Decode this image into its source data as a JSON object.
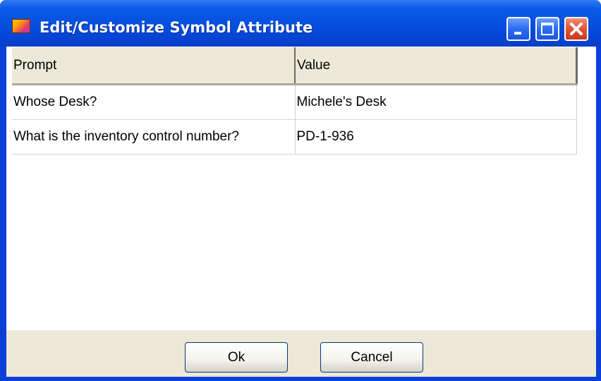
{
  "window": {
    "title": "Edit/Customize Symbol Attribute"
  },
  "grid": {
    "columns": [
      "Prompt",
      "Value"
    ],
    "rows": [
      {
        "prompt": "Whose Desk?",
        "value": "Michele's Desk"
      },
      {
        "prompt": "What is the inventory control number?",
        "value": "PD-1-936"
      }
    ]
  },
  "buttons": {
    "ok_label": "Ok",
    "cancel_label": "Cancel"
  },
  "icons": {
    "app": "symbol-attribute-app-icon",
    "minimize": "minimize-icon",
    "maximize": "maximize-icon",
    "close": "close-icon"
  },
  "colors": {
    "titlebar": "#0652e0",
    "close_button": "#e05a38",
    "dialog_face": "#ece9d8"
  }
}
